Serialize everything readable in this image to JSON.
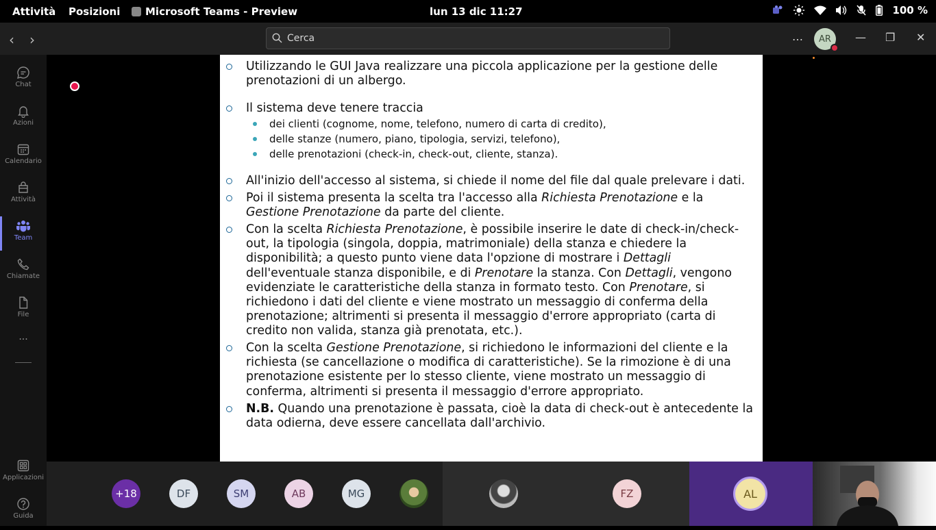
{
  "topbar": {
    "activities": "Attività",
    "positions": "Posizioni",
    "app_title": "Microsoft Teams - Preview",
    "clock": "lun 13 dic  11:27",
    "battery": "100 %",
    "icons": [
      "teams-tray-icon",
      "brightness-icon",
      "wifi-icon",
      "volume-icon",
      "mic-muted-icon",
      "battery-icon"
    ]
  },
  "titlebar": {
    "search_placeholder": "Cerca",
    "avatar_initials": "AR",
    "more": "…",
    "minimize": "—",
    "restore": "❐",
    "close": "✕"
  },
  "sidebar": {
    "items": [
      {
        "label": "Chat",
        "icon": "chat-icon"
      },
      {
        "label": "Azioni",
        "icon": "bell-icon"
      },
      {
        "label": "Calendario",
        "icon": "calendar-icon"
      },
      {
        "label": "Attività",
        "icon": "bag-icon"
      },
      {
        "label": "Team",
        "icon": "team-icon",
        "active": true
      },
      {
        "label": "Chiamate",
        "icon": "phone-icon"
      },
      {
        "label": "File",
        "icon": "file-icon"
      }
    ],
    "more": "···",
    "bottom": [
      {
        "label": "Applicazioni",
        "icon": "apps-icon"
      },
      {
        "label": "Guida",
        "icon": "help-icon"
      }
    ]
  },
  "slide": {
    "b1": "Utilizzando le GUI Java realizzare una piccola applicazione per la gestione delle prenotazioni di un albergo.",
    "b2": "Il sistema deve tenere traccia",
    "b2_sub": [
      "dei clienti (cognome, nome, telefono, numero di carta di credito),",
      "delle stanze (numero, piano, tipologia, servizi, telefono),",
      "delle prenotazioni (check-in, check-out, cliente, stanza)."
    ],
    "b3": "All'inizio dell'accesso al sistema, si chiede il nome del file dal quale prelevare i dati.",
    "b4": {
      "t1": "Poi il sistema presenta la scelta tra l'accesso alla ",
      "i1": "Richiesta Prenotazione",
      "t2": " e la ",
      "i2": "Gestione Prenotazione",
      "t3": " da parte del cliente."
    },
    "b5": {
      "t1": "Con la scelta ",
      "i1": "Richiesta Prenotazione",
      "t2": ", è possibile inserire le date di check-in/check-out, la tipologia (singola, doppia, matrimoniale) della stanza e chiedere la disponibilità; a questo punto viene data l'opzione di mostrare i ",
      "i2": "Dettagli",
      "t3": " dell'eventuale stanza disponibile, e di ",
      "i3": "Prenotare",
      "t4": " la stanza. Con ",
      "i4": "Dettagli",
      "t5": ", vengono evidenziate le caratteristiche della stanza in formato testo. Con ",
      "i5": "Prenotare",
      "t6": ", si richiedono i dati del cliente e viene mostrato un messaggio di conferma della prenotazione; altrimenti si presenta il messaggio d'errore appropriato (carta di credito non valida, stanza già prenotata, etc.)."
    },
    "b6": {
      "t1": "Con la scelta ",
      "i1": "Gestione Prenotazione",
      "t2": ", si richiedono le informazioni del cliente e la richiesta (se cancellazione o modifica di caratteristiche). Se la rimozione è di una prenotazione esistente per lo stesso cliente, viene mostrato un messaggio di conferma, altrimenti si presenta il messaggio d'errore appropriato."
    },
    "b7": {
      "bold": "N.B.",
      "t1": " Quando una prenotazione è passata, cioè la data di check-out è antecedente la data odierna, deve essere cancellata dall'archivio."
    }
  },
  "participants": {
    "more_count": "+18",
    "avatars": [
      {
        "initials": "DF",
        "color": "#dde3ea",
        "text": "#3b4a5a"
      },
      {
        "initials": "SM",
        "color": "#d5d6f0",
        "text": "#3e3f73"
      },
      {
        "initials": "AB",
        "color": "#ecd3e5",
        "text": "#6e3a5d"
      },
      {
        "initials": "MG",
        "color": "#dde3ea",
        "text": "#3b4a5a"
      }
    ],
    "tile_fz": "FZ",
    "tile_al": "AL"
  }
}
